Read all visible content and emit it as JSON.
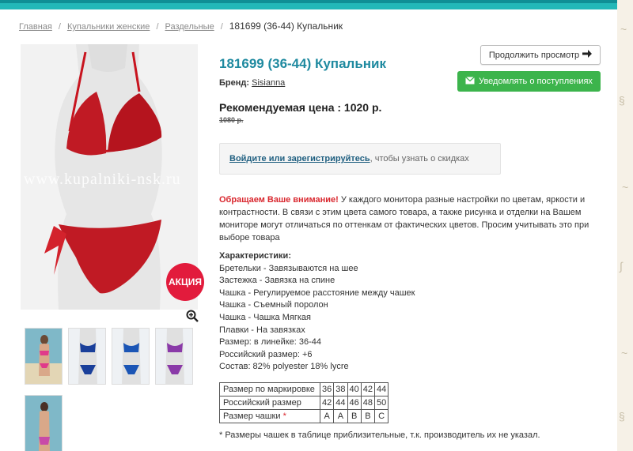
{
  "breadcrumb": {
    "items": [
      "Главная",
      "Купальники женские",
      "Раздельные"
    ],
    "current": "181699 (36-44) Купальник"
  },
  "product": {
    "title": "181699 (36-44) Купальник",
    "brand_label": "Бренд:",
    "brand": "Sisianna",
    "price": "Рекомендуемая цена : 1020 р.",
    "old_price": "1080 р.",
    "sale_badge": "АКЦИЯ",
    "watermark": "www.kupalniki-nsk.ru"
  },
  "buttons": {
    "continue": "Продолжить просмотр",
    "notify": "Уведомлять о поступлениях"
  },
  "login_box": {
    "link": "Войдите или зарегистрируйтесь",
    "rest": ", чтобы узнать о скидках"
  },
  "notice": {
    "highlight": "Обращаем Ваше внимание!",
    "text": " У каждого монитора разные настройки по цветам, яркости и контрастности. В связи с этим цвета самого товара, а также рисунка и отделки на Вашем мониторе могут отличаться по оттенкам от фактических цветов. Просим учитывать это при выборе товара"
  },
  "specs": {
    "heading": "Характеристики:",
    "lines": [
      "Бретельки - Завязываются на шее",
      "Застежка - Завязка на спине",
      "Чашка - Регулируемое расстояние между чашек",
      "Чашка - Съемный поролон",
      "Чашка - Чашка Мягкая",
      "Плавки - На завязках",
      "Размер: в линейке: 36-44",
      "Российский размер: +6",
      "Состав: 82% polyester 18% lycre"
    ]
  },
  "size_table": {
    "rows": [
      {
        "label": "Размер по маркировке",
        "cells": [
          "36",
          "38",
          "40",
          "42",
          "44"
        ]
      },
      {
        "label": "Российский размер",
        "cells": [
          "42",
          "44",
          "46",
          "48",
          "50"
        ]
      },
      {
        "label": "Размер чашки",
        "asterisk": "*",
        "cells": [
          "A",
          "A",
          "B",
          "B",
          "C"
        ]
      }
    ],
    "footnote": "* Размеры чашек в таблице приблизительные, т.к. производитель их не указал."
  },
  "icons": {
    "continue": "arrow-right-icon",
    "notify": "envelope-icon",
    "zoom": "magnifier-plus-icon"
  },
  "colors": {
    "accent": "#1f8aa0",
    "topbar": "#22b8b8",
    "notify_button": "#3cb44c",
    "sale_badge": "#e21b3c",
    "notice_red": "#d9272e"
  }
}
